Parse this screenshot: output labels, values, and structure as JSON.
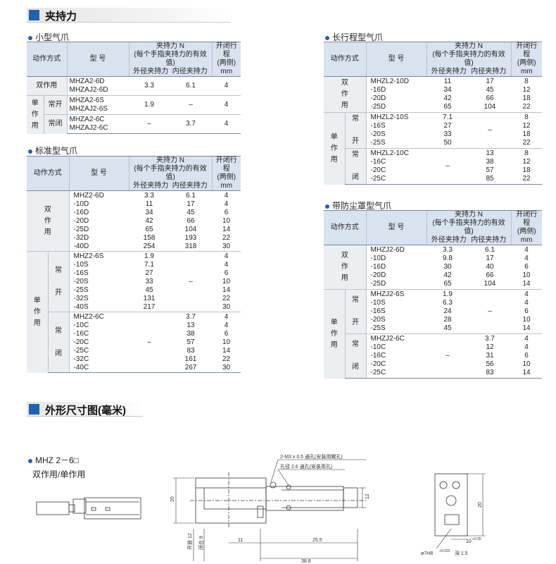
{
  "section1": {
    "title": "夹持力"
  },
  "section2": {
    "title": "外形尺寸图(毫米)"
  },
  "header": {
    "action": "动作方式",
    "model": "型  号",
    "force": "夹持力 N",
    "force_note": "(每个手指夹持力的有效值)",
    "outer": "外径夹持力",
    "inner": "内径夹持力",
    "stroke": "开闭行程\n(两侧)\nmm",
    "stroke2": "开闭行程\n(两侧)\nmm"
  },
  "labels": {
    "double": "双\n作\n用",
    "double_single": "双作用",
    "single": "单\n作\n用",
    "no_open": "常\n\n开",
    "nc_close": "常\n\n闭",
    "no_h": "常开",
    "nc_h": "常闭"
  },
  "small": {
    "title": "小型气爪",
    "rows": [
      {
        "model": "MHZA2-6D\nMHZAJ2-6D",
        "outer": "3.3",
        "inner": "6.1",
        "stroke": "4"
      },
      {
        "model": "MHZA2-6S\nMHZAJ2-6S",
        "outer": "1.9",
        "inner": "–",
        "stroke": "4"
      },
      {
        "model": "MHZA2-6C\nMHZAJ2-6C",
        "outer": "–",
        "inner": "3.7",
        "stroke": "4"
      }
    ]
  },
  "standard": {
    "title": "标准型气爪",
    "models": "MHZ2-6D\n-10D\n-16D\n-20D\n-25D\n-32D\n-40D",
    "d_outer": "3.3\n11\n34\n42\n65\n158\n254",
    "d_inner": "6.1\n17\n45\n66\n104\n193\n318",
    "d_stroke": "4\n4\n6\n10\n14\n22\n30",
    "s_models": "MHZ2-6S\n-10S\n-16S\n-20S\n-25S\n-32S\n-40S",
    "s_outer": "1.9\n7.1\n27\n33\n45\n131\n217",
    "s_inner": "–",
    "s_stroke": "4\n4\n6\n10\n14\n22\n30",
    "c_models": "MHZ2-6C\n-10C\n-16C\n-20C\n-25C\n-32C\n-40C",
    "c_outer": "–",
    "c_inner": "3.7\n13\n38\n57\n83\n161\n267",
    "c_stroke": "4\n4\n6\n10\n14\n22\n30"
  },
  "long": {
    "title": "长行程型气爪",
    "d_models": "MHZL2-10D\n-16D\n-20D\n-25D",
    "d_outer": "11\n34\n42\n65",
    "d_inner": "17\n45\n66\n104",
    "d_stroke": "8\n12\n18\n22",
    "s_models": "MHZL2-10S\n-16S\n-20S\n-25S",
    "s_outer": "7.1\n27\n33\n50",
    "s_inner": "–",
    "s_stroke": "8\n12\n18\n22",
    "c_models": "MHZL2-10C\n-16C\n-20C\n-25C",
    "c_outer": "–",
    "c_inner": "13\n38\n57\n85",
    "c_stroke": "8\n12\n18\n22"
  },
  "dust": {
    "title": "带防尘罩型气爪",
    "d_models": "MHZJ2-6D\n-10D\n-16D\n-20D\n-25D",
    "d_outer": "3.3\n9.8\n30\n42\n65",
    "d_inner": "6.1\n17\n40\n66\n104",
    "d_stroke": "4\n4\n6\n10\n14",
    "s_models": "MHZJ2-6S\n-10S\n-16S\n-20S\n-25S",
    "s_outer": "1.9\n6.3\n24\n28\n45",
    "s_inner": "–",
    "s_stroke": "4\n4\n6\n10\n14",
    "c_models": "MHZJ2-6C\n-10C\n-16C\n-20C\n-25C",
    "c_outer": "–",
    "c_inner": "3.7\n12\n31\n56\n83",
    "c_stroke": "4\n4\n6\n10\n14"
  },
  "drawing": {
    "model": "MHZ 2－6□",
    "type": "双作用/单作用",
    "note1": "2-M3 x 0.5  通孔(安装用螺孔)",
    "note2": "孔径 2.6  通孔(安装用孔)",
    "dim_20": "20",
    "dim_12": "12",
    "dim_11": "11",
    "dim_25_5": "25.5",
    "dim_38_8": "38.8",
    "dim_open": "开放 12",
    "dim_close": "闭合 8",
    "dim_20b": "20",
    "dim_10": "10",
    "dim_tol": "+0.05",
    "dim_bore": "ø7H8",
    "dim_bore_tol": "+0.022",
    "dim_depth": "深 1.5"
  }
}
